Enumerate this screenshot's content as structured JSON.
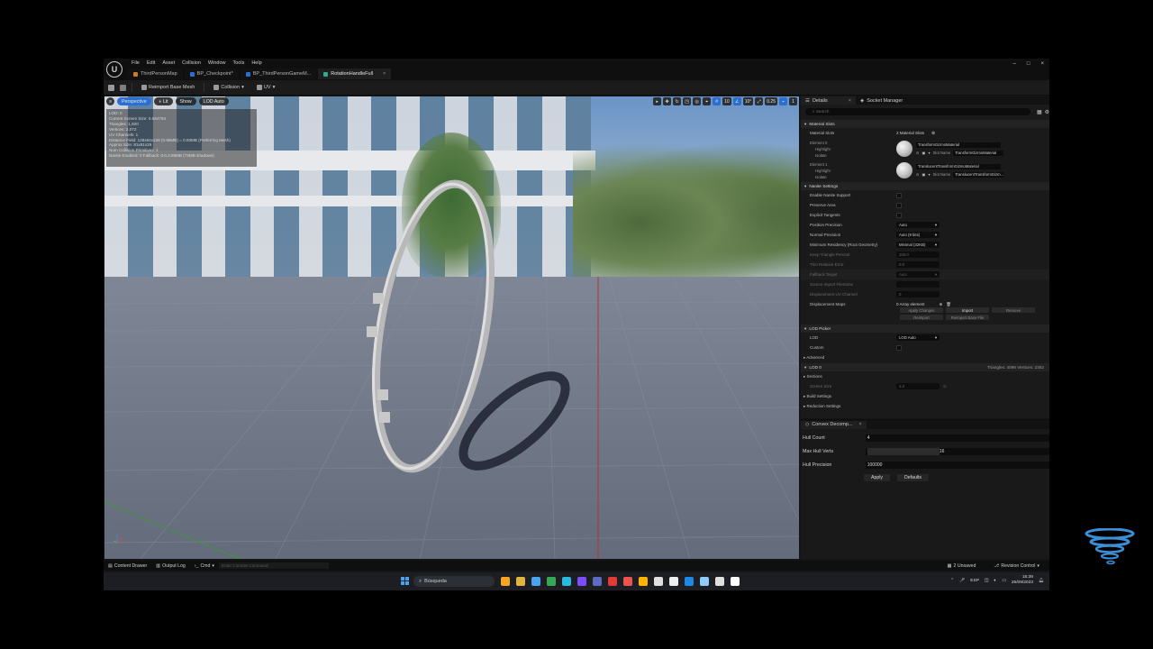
{
  "app": {
    "logo_text": "U",
    "menu": [
      "File",
      "Edit",
      "Asset",
      "Collision",
      "Window",
      "Tools",
      "Help"
    ],
    "tabs": [
      {
        "label": "ThirdPersonMap",
        "color": "#c57d2b",
        "active": false
      },
      {
        "label": "BP_Checkpoint*",
        "color": "#2a6fd1",
        "active": false
      },
      {
        "label": "BP_ThirdPersonGameM...",
        "color": "#2a6fd1",
        "active": false
      },
      {
        "label": "RotationHandleFull",
        "color": "#2fae8c",
        "active": true,
        "close": "×"
      }
    ],
    "window_controls": [
      "–",
      "□",
      "×"
    ]
  },
  "toolbar": {
    "reimport": "Reimport Base Mesh",
    "collision": "Collision",
    "uv": "UV"
  },
  "viewport": {
    "perspective": "Perspective",
    "lit": "Lit",
    "show": "Show",
    "lod": "LOD Auto",
    "right_tools": [
      "10",
      "10°",
      "0.25",
      "1"
    ],
    "stats": [
      "LOD: 0",
      "Current Screen Size: 0.584784",
      "Triangles: 1,920",
      "Vertices: 2,072",
      "UV Channels: 1",
      "Distance Field: 128x64x128 (0.99MB) = 0.00MB (Preferring Mesh)",
      "Approx Size: 81x81x29",
      "Num Collision Primitives: 1",
      "Nanite Enabled: 0 Fallback: 0.0,3.89MB (73MB shadows)"
    ]
  },
  "details": {
    "tab_details": "Details",
    "tab_socket": "Socket Manager",
    "search_placeholder": "Search",
    "material_slots_section": "Material Slots",
    "material_slots_label": "Material Slots",
    "material_slots_value": "2 Material Slots",
    "elements": [
      {
        "name": "Element 0",
        "highlight": "Highlight",
        "isolate": "Isolate",
        "material": "TransformGizmoMaterial",
        "slot_label": "Slot Name",
        "slot_name": "TransformGizmoMaterial"
      },
      {
        "name": "Element 1",
        "highlight": "Highlight",
        "isolate": "Isolate",
        "material": "TranslucentTransformGizmoMaterial",
        "slot_label": "Slot Name",
        "slot_name": "TranslucentTransformGizm..."
      }
    ],
    "nanite_section": "Nanite Settings",
    "nanite_rows": [
      {
        "label": "Enable Nanite Support",
        "kind": "check",
        "dim": false
      },
      {
        "label": "Preserve Area",
        "kind": "check",
        "dim": false
      },
      {
        "label": "Explicit Tangents",
        "kind": "check",
        "dim": false
      },
      {
        "label": "Position Precision",
        "kind": "combo",
        "value": "Auto",
        "dim": false
      },
      {
        "label": "Normal Precision",
        "kind": "combo",
        "value": "Auto (8 bits)",
        "dim": false
      },
      {
        "label": "Minimum Residency (Root Geometry)",
        "kind": "combo",
        "value": "Minimal (32KB)",
        "dim": false
      },
      {
        "label": "Keep Triangle Percent",
        "kind": "num",
        "value": "100.0",
        "dim": true
      },
      {
        "label": "Trim Relative Error",
        "kind": "num",
        "value": "0.0",
        "dim": true
      },
      {
        "label": "Fallback Target",
        "kind": "combo",
        "value": "Auto",
        "dim": true
      },
      {
        "label": "Source Import Filename",
        "kind": "num",
        "value": "",
        "dim": true
      },
      {
        "label": "Displacement UV Channel",
        "kind": "num",
        "value": "0",
        "dim": true
      }
    ],
    "displacement_label": "Displacement Maps",
    "displacement_value": "0 Array element",
    "buttons_row1": [
      "Apply Changes",
      "Import",
      "Remove"
    ],
    "buttons_row2": [
      "Reimport",
      "Reimport Base File"
    ],
    "lod_picker_section": "LOD Picker",
    "lod_label": "LOD",
    "lod_value": "LOD Auto",
    "custom_label": "Custom",
    "advanced": "Advanced",
    "lod0_section": "LOD 0",
    "lod0_stats": "Triangles: 4096   Vertices: 2362",
    "sections": "Sections",
    "screen_size_label": "Screen Size",
    "screen_size_value": "1.0",
    "build_settings": "Build Settings",
    "reduction_settings": "Reduction Settings"
  },
  "convex": {
    "tab": "Convex Decomp...",
    "hull_count_label": "Hull Count",
    "hull_count": "4",
    "max_hull_verts_label": "Max Hull Verts",
    "max_hull_verts": "16",
    "max_hull_verts_fraction": 0.4,
    "hull_precision_label": "Hull Precision",
    "hull_precision": "100000",
    "apply": "Apply",
    "defaults": "Defaults"
  },
  "statusbar": {
    "content_drawer": "Content Drawer",
    "output_log": "Output Log",
    "cmd": "Cmd",
    "cmd_placeholder": "Enter Console Command",
    "unsaved": "2 Unsaved",
    "revision": "Revision Control"
  },
  "taskbar": {
    "search": "Búsqueda",
    "icon_colors": [
      "#f5a623",
      "#e2b33d",
      "#4aa3ef",
      "#34a853",
      "#2ab7e0",
      "#7c4dff",
      "#5c6bc0",
      "#e53935",
      "#ef5350",
      "#ffb300",
      "#e0e0e0",
      "#eeeeee",
      "#1e88e5",
      "#90caf9",
      "#e0e0e0",
      "#ffffff"
    ],
    "language": "ESP",
    "time": "15:39",
    "date": "25/09/2023"
  }
}
